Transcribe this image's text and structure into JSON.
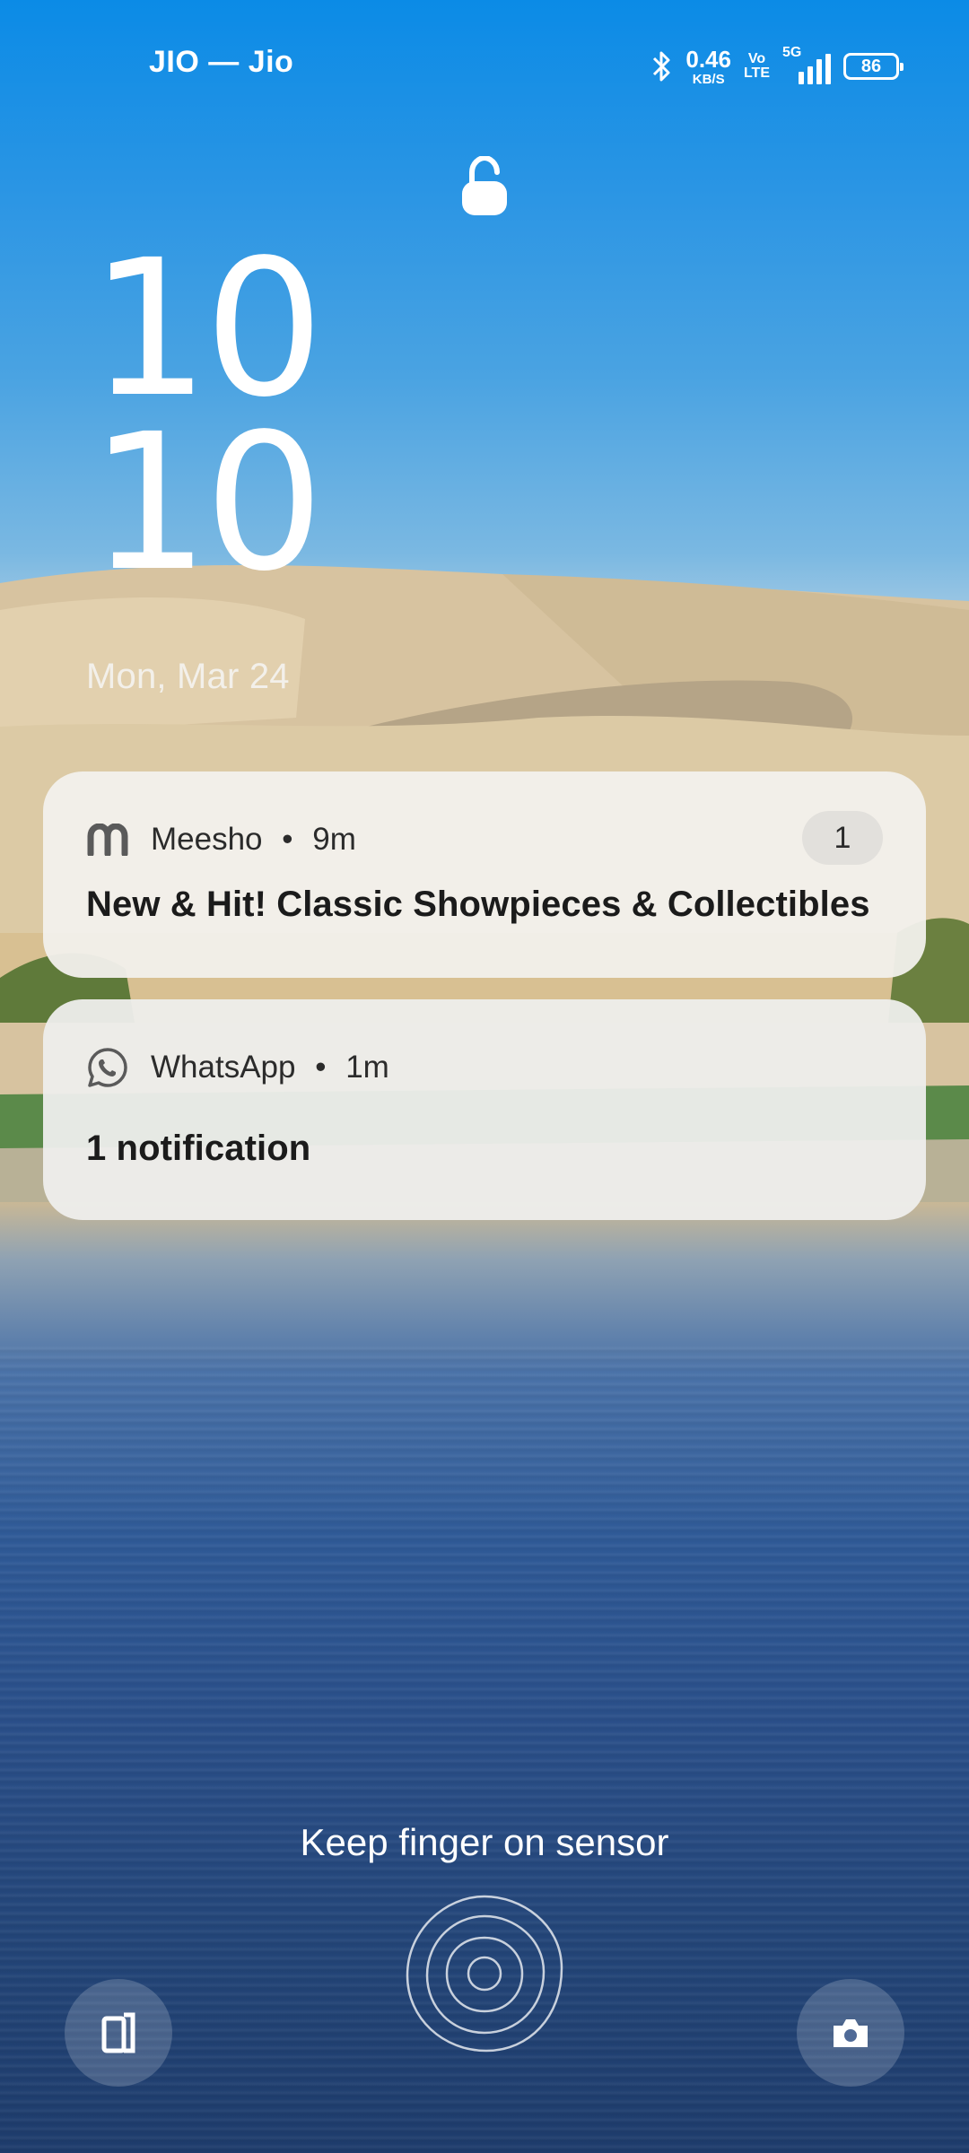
{
  "status_bar": {
    "carrier": "JIO — Jio",
    "net_speed_value": "0.46",
    "net_speed_unit": "KB/S",
    "volte_top": "Vo",
    "volte_bottom": "LTE",
    "network_type": "5G",
    "battery": "86",
    "icons": [
      "bluetooth-icon",
      "signal-icon",
      "battery-icon"
    ]
  },
  "lockscreen": {
    "clock_hours": "10",
    "clock_minutes": "10",
    "date": "Mon, Mar 24"
  },
  "notifications": [
    {
      "app": "Meesho",
      "sep": "•",
      "time": "9m",
      "count": "1",
      "body": "New & Hit! Classic Showpieces & Collectibles",
      "icon": "meesho-icon"
    },
    {
      "app": "WhatsApp",
      "sep": "•",
      "time": "1m",
      "body": "1 notification",
      "icon": "whatsapp-icon"
    }
  ],
  "bottom": {
    "hint": "Keep finger on sensor",
    "left_shortcut_icon": "wallet-icon",
    "right_shortcut_icon": "camera-icon"
  },
  "colors": {
    "sky_top": "#0b8be6",
    "notification_bg": "#f2f0ec",
    "text_dark": "#1b1b1b"
  }
}
